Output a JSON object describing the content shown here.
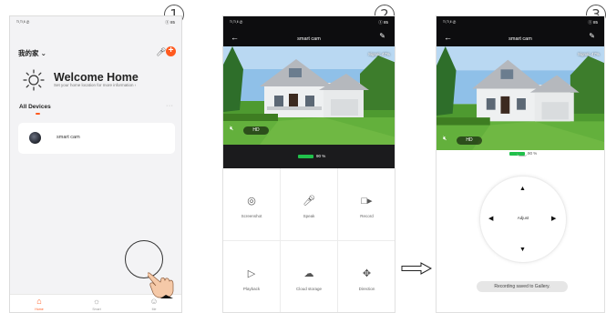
{
  "steps": [
    "1",
    "2",
    "3"
  ],
  "phone1": {
    "status_left": "ᵀᴵ.ᵀᴵ.ᴵᴵ ✆",
    "status_right": "ⓢ 85",
    "home_name": "我的家 ⌄",
    "welcome_title": "Welcome Home",
    "welcome_sub": "Set your home location for more information ›",
    "devices_label": "All Devices",
    "more": "···",
    "device_name": "smart cam",
    "tabs": [
      {
        "label": "Home",
        "icon": "home-icon"
      },
      {
        "label": "Smart",
        "icon": "smart-icon"
      },
      {
        "label": "Me",
        "icon": "profile-icon"
      }
    ]
  },
  "camera": {
    "title": "smart cam",
    "signal": "Signal: 47%",
    "hd_label": "HD",
    "battery": "90 %",
    "battery_level": 0.9,
    "status_left": "ᵀᴵ.ᵀᴵ.ᴵᴵ ✆",
    "status_right": "ⓢ 85"
  },
  "controls": [
    {
      "label": "Screenshot",
      "icon": "camera-icon"
    },
    {
      "label": "Speak",
      "icon": "microphone-icon"
    },
    {
      "label": "Record",
      "icon": "video-icon"
    },
    {
      "label": "Playback",
      "icon": "playback-icon"
    },
    {
      "label": "Cloud storage",
      "icon": "cloud-icon"
    },
    {
      "label": "Direction",
      "icon": "move-icon"
    }
  ],
  "phone3": {
    "battery": "90 %",
    "adjust": "Adjust",
    "toast": "Recording saved to Gallery."
  },
  "colors": {
    "accent": "#ff5a1f",
    "battery": "#21c04b",
    "dark": "#0d0d0f"
  }
}
